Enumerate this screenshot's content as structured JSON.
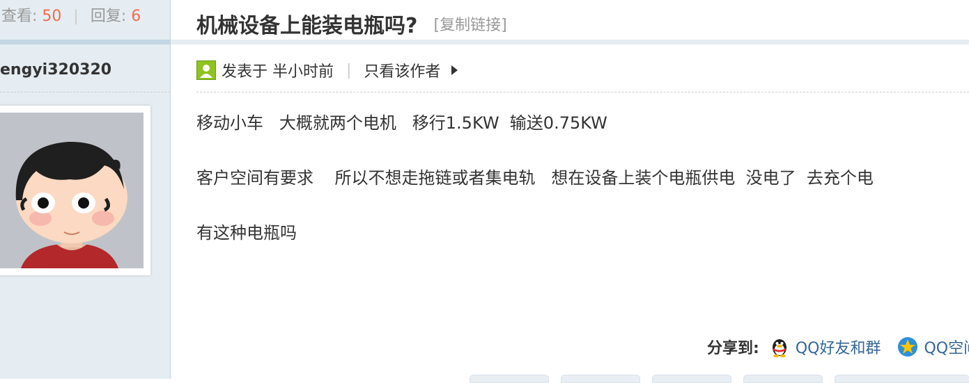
{
  "stats": {
    "views_label": "查看:",
    "views_value": "50",
    "separator": "|",
    "replies_label": "回复:",
    "replies_value": "6"
  },
  "author": {
    "name": "engyi320320"
  },
  "thread": {
    "title": "机械设备上能装电瓶吗?",
    "copy_link": "[复制链接]"
  },
  "post_meta": {
    "posted_at": "发表于 半小时前",
    "separator": "|",
    "only_author": "只看该作者"
  },
  "post_body": {
    "lines": [
      "移动小车   大概就两个电机   移行1.5KW  输送0.75KW",
      "客户空间有要求    所以不想走拖链或者集电轨   想在设备上装个电瓶供电  没电了  去充个电",
      "有这种电瓶吗"
    ]
  },
  "share": {
    "label": "分享到:",
    "items": [
      {
        "label": "QQ好友和群",
        "icon": "qq-penguin-icon"
      },
      {
        "label": "QQ空间",
        "icon": "qzone-star-icon"
      }
    ]
  },
  "colors": {
    "accent_number": "#f26c4f",
    "link": "#336699",
    "sidebar_bg": "#e5edf2",
    "band": "#c2d5e3"
  }
}
